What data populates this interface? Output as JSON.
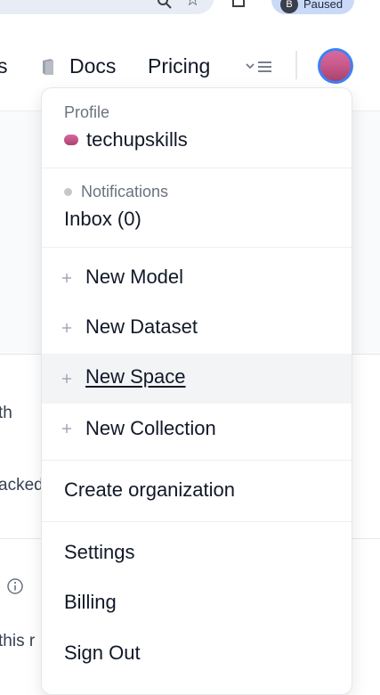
{
  "browser": {
    "paused_avatar": "B",
    "paused_label": "Paused"
  },
  "nav": {
    "partial_item": "s",
    "docs": "Docs",
    "pricing": "Pricing"
  },
  "background": {
    "partial_1": "th",
    "partial_2": "acked",
    "partial_3": "this r"
  },
  "menu": {
    "profile": {
      "label": "Profile",
      "username": "techupskills"
    },
    "notifications": {
      "label": "Notifications",
      "inbox": "Inbox (0)"
    },
    "create_items": [
      {
        "label": "New Model"
      },
      {
        "label": "New Dataset"
      },
      {
        "label": "New Space"
      },
      {
        "label": "New Collection"
      }
    ],
    "create_org": "Create organization",
    "account_items": [
      {
        "label": "Settings"
      },
      {
        "label": "Billing"
      },
      {
        "label": "Sign Out"
      }
    ]
  },
  "colors": {
    "accent_avatar_ring": "#3b82f6",
    "avatar_gradient_top": "#d86aa0",
    "avatar_gradient_bottom": "#a9426e",
    "highlight_row": "#f3f4f6"
  }
}
